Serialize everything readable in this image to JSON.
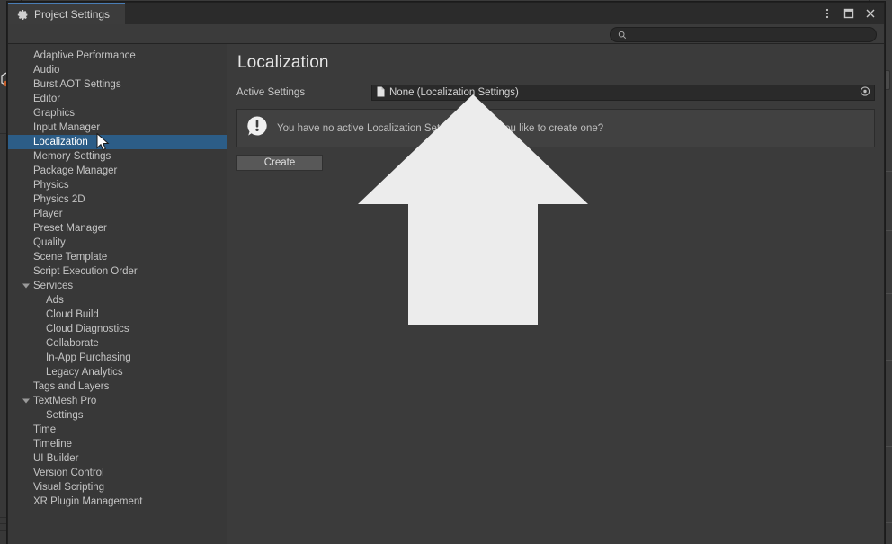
{
  "window": {
    "tab_label": "Project Settings",
    "tab_icon": "gear-icon",
    "controls": [
      {
        "name": "more-options-button",
        "icon": "vertical-ellipsis-icon"
      },
      {
        "name": "maximize-button",
        "icon": "maximize-square-icon"
      },
      {
        "name": "close-button",
        "icon": "close-x-icon"
      }
    ]
  },
  "search": {
    "value": "",
    "placeholder": "",
    "icon": "search-icon"
  },
  "sidebar": {
    "items": [
      {
        "label": "Adaptive Performance",
        "level": 0,
        "selected": false,
        "foldout": false
      },
      {
        "label": "Audio",
        "level": 0,
        "selected": false,
        "foldout": false
      },
      {
        "label": "Burst AOT Settings",
        "level": 0,
        "selected": false,
        "foldout": false
      },
      {
        "label": "Editor",
        "level": 0,
        "selected": false,
        "foldout": false
      },
      {
        "label": "Graphics",
        "level": 0,
        "selected": false,
        "foldout": false
      },
      {
        "label": "Input Manager",
        "level": 0,
        "selected": false,
        "foldout": false
      },
      {
        "label": "Localization",
        "level": 0,
        "selected": true,
        "foldout": false
      },
      {
        "label": "Memory Settings",
        "level": 0,
        "selected": false,
        "foldout": false
      },
      {
        "label": "Package Manager",
        "level": 0,
        "selected": false,
        "foldout": false
      },
      {
        "label": "Physics",
        "level": 0,
        "selected": false,
        "foldout": false
      },
      {
        "label": "Physics 2D",
        "level": 0,
        "selected": false,
        "foldout": false
      },
      {
        "label": "Player",
        "level": 0,
        "selected": false,
        "foldout": false
      },
      {
        "label": "Preset Manager",
        "level": 0,
        "selected": false,
        "foldout": false
      },
      {
        "label": "Quality",
        "level": 0,
        "selected": false,
        "foldout": false
      },
      {
        "label": "Scene Template",
        "level": 0,
        "selected": false,
        "foldout": false
      },
      {
        "label": "Script Execution Order",
        "level": 0,
        "selected": false,
        "foldout": false
      },
      {
        "label": "Services",
        "level": 0,
        "selected": false,
        "foldout": true
      },
      {
        "label": "Ads",
        "level": 1,
        "selected": false,
        "foldout": false
      },
      {
        "label": "Cloud Build",
        "level": 1,
        "selected": false,
        "foldout": false
      },
      {
        "label": "Cloud Diagnostics",
        "level": 1,
        "selected": false,
        "foldout": false
      },
      {
        "label": "Collaborate",
        "level": 1,
        "selected": false,
        "foldout": false
      },
      {
        "label": "In-App Purchasing",
        "level": 1,
        "selected": false,
        "foldout": false
      },
      {
        "label": "Legacy Analytics",
        "level": 1,
        "selected": false,
        "foldout": false
      },
      {
        "label": "Tags and Layers",
        "level": 0,
        "selected": false,
        "foldout": false
      },
      {
        "label": "TextMesh Pro",
        "level": 0,
        "selected": false,
        "foldout": true
      },
      {
        "label": "Settings",
        "level": 1,
        "selected": false,
        "foldout": false
      },
      {
        "label": "Time",
        "level": 0,
        "selected": false,
        "foldout": false
      },
      {
        "label": "Timeline",
        "level": 0,
        "selected": false,
        "foldout": false
      },
      {
        "label": "UI Builder",
        "level": 0,
        "selected": false,
        "foldout": false
      },
      {
        "label": "Version Control",
        "level": 0,
        "selected": false,
        "foldout": false
      },
      {
        "label": "Visual Scripting",
        "level": 0,
        "selected": false,
        "foldout": false
      },
      {
        "label": "XR Plugin Management",
        "level": 0,
        "selected": false,
        "foldout": false
      }
    ]
  },
  "main": {
    "title": "Localization",
    "active_settings": {
      "label": "Active Settings",
      "value": "None (Localization Settings)",
      "value_icon": "document-icon",
      "picker_icon": "object-picker-icon"
    },
    "helpbox": {
      "icon": "warning-icon",
      "message": "You have no active Localization Settings. Would you like to create one?"
    },
    "create_button": "Create"
  },
  "overlay": {
    "arrow_icon": "up-arrow-annotation",
    "arrow_color": "#ececec",
    "cursor_icon": "mouse-pointer-icon"
  },
  "colors": {
    "selection_blue": "#2c5d87",
    "tab_accent": "#4a7db5",
    "window_bg": "#383838",
    "content_bg": "#3b3b3b",
    "field_bg": "#2a2a2a",
    "helpbox_bg": "#414141",
    "button_bg": "#585858"
  }
}
